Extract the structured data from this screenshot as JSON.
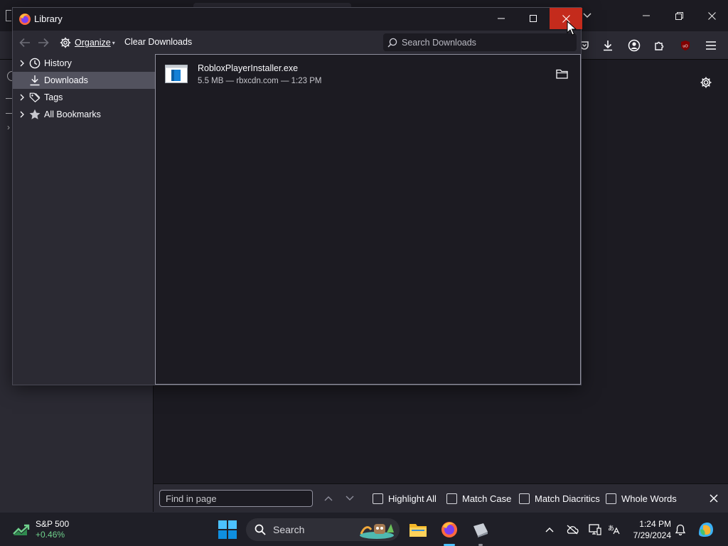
{
  "library": {
    "title": "Library",
    "toolbar": {
      "organize_label": "Organize",
      "clear_downloads_label": "Clear Downloads",
      "search_placeholder": "Search Downloads"
    },
    "tree": [
      {
        "label": "History",
        "icon": "clock-icon"
      },
      {
        "label": "Downloads",
        "icon": "download-icon",
        "selected": true
      },
      {
        "label": "Tags",
        "icon": "tag-icon"
      },
      {
        "label": "All Bookmarks",
        "icon": "star-icon"
      }
    ],
    "downloads": [
      {
        "name": "RobloxPlayerInstaller.exe",
        "meta": "5.5 MB — rbxcdn.com — 1:23 PM"
      }
    ]
  },
  "findbar": {
    "placeholder": "Find in page",
    "options": [
      "Highlight All",
      "Match Case",
      "Match Diacritics",
      "Whole Words"
    ]
  },
  "taskbar": {
    "widget": {
      "title": "S&P 500",
      "value": "+0.46%"
    },
    "search_label": "Search",
    "clock": {
      "time": "1:24 PM",
      "date": "7/29/2024"
    }
  },
  "colors": {
    "accent": "#4cc2ff",
    "close_red": "#c42b1c",
    "stock_green": "#6fd08c"
  }
}
